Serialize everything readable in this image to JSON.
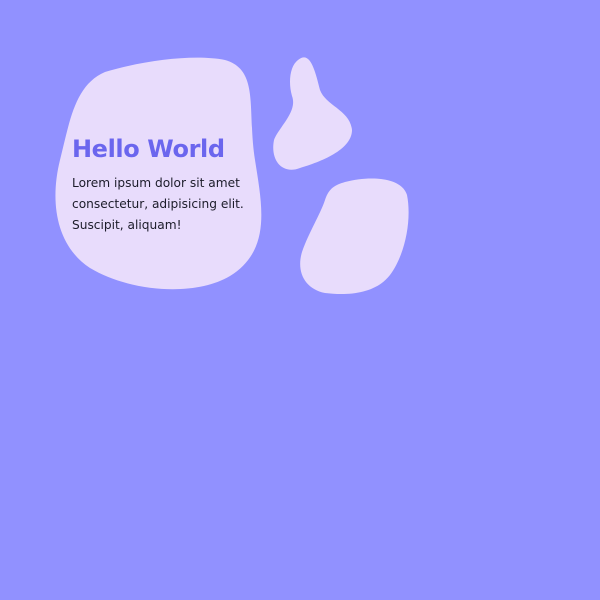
{
  "card": {
    "title": "Hello World",
    "body_lines": [
      "Lorem ipsum dolor sit amet",
      "consectetur, adipisicing elit.",
      "Suscipit, aliquam!"
    ]
  },
  "colors": {
    "background": "#9191ff",
    "blob": "#e8dcfc",
    "title": "#6b66ee",
    "text": "#1c1c2a"
  }
}
